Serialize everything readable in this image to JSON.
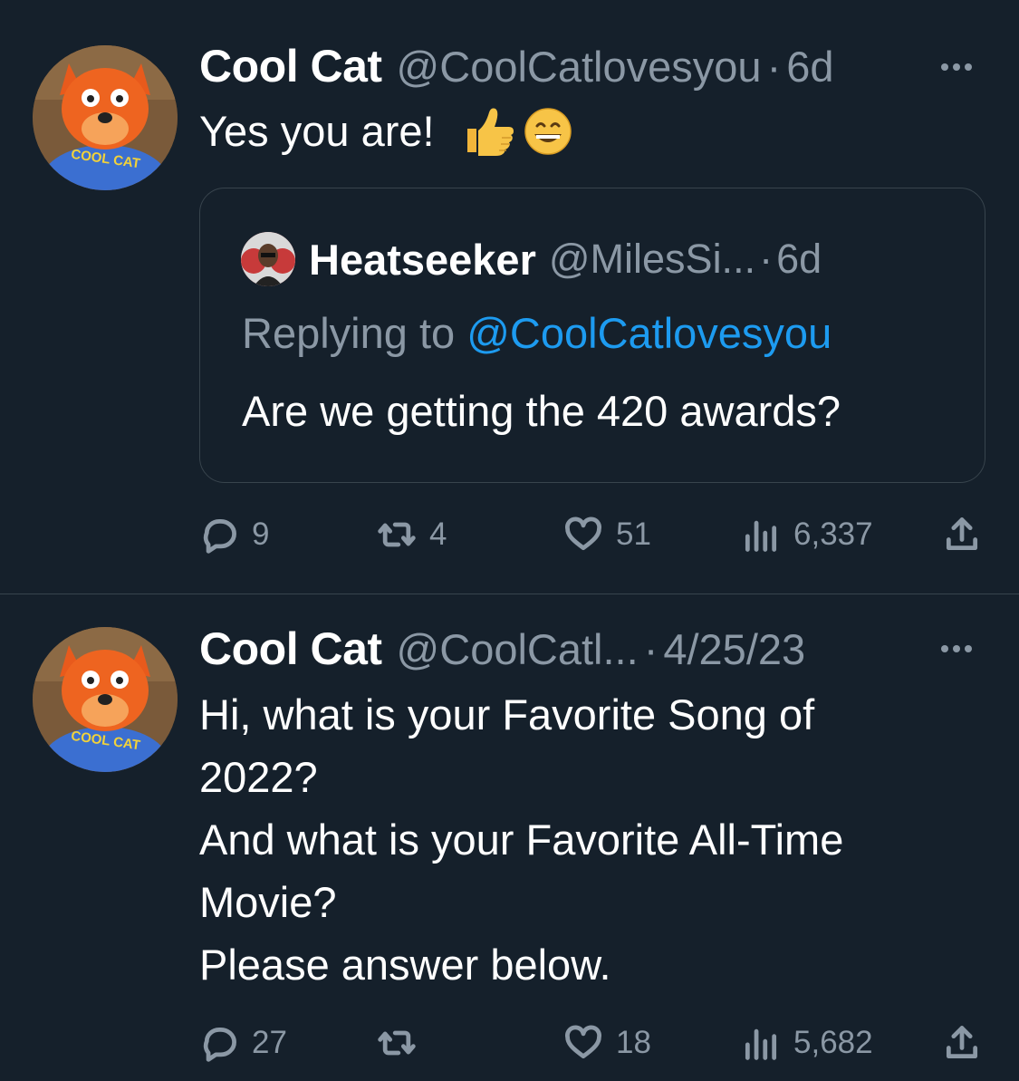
{
  "tweets": [
    {
      "author": "Cool Cat",
      "handle": "@CoolCatlovesyou",
      "separator": "·",
      "date": "6d",
      "text": "Yes you are!",
      "emojis": [
        "thumbs-up",
        "grinning-face"
      ],
      "avatar_shirt_text": "COOL CAT",
      "quote": {
        "author": "Heatseeker",
        "handle": "@MilesSi...",
        "separator": "·",
        "date": "6d",
        "replying_prefix": "Replying to ",
        "replying_handle": "@CoolCatlovesyou",
        "text": "Are we getting the 420 awards?"
      },
      "stats": {
        "replies": "9",
        "retweets": "4",
        "likes": "51",
        "views": "6,337"
      }
    },
    {
      "author": "Cool Cat",
      "handle": "@CoolCatl...",
      "separator": "·",
      "date": "4/25/23",
      "text": "Hi, what is your Favorite Song of\n2022?\nAnd what is your Favorite All-Time\nMovie?\nPlease answer below.",
      "avatar_shirt_text": "COOL CAT",
      "stats": {
        "replies": "27",
        "retweets": "",
        "likes": "18",
        "views": "5,682"
      }
    }
  ],
  "colors": {
    "background": "#15202b",
    "muted": "#8b98a5",
    "link": "#1d9bf0",
    "divider": "#38444d"
  }
}
